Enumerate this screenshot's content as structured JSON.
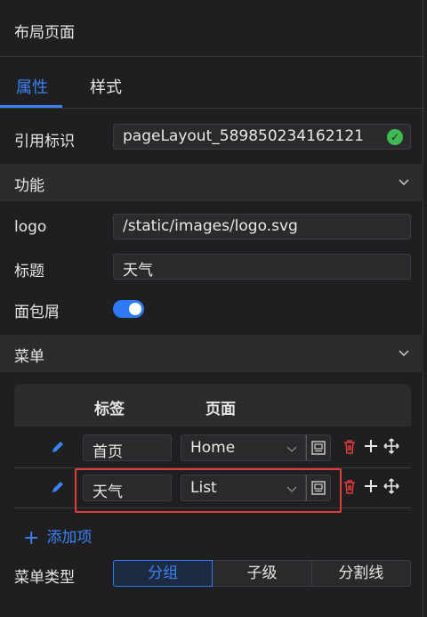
{
  "header": {
    "title": "布局页面"
  },
  "tabs": [
    {
      "label": "属性",
      "active": true
    },
    {
      "label": "样式",
      "active": false
    }
  ],
  "ref_id": {
    "label": "引用标识",
    "value": "pageLayout_589850234162121"
  },
  "section_function": {
    "label": "功能"
  },
  "logo": {
    "label": "logo",
    "value": "/static/images/logo.svg"
  },
  "title_field": {
    "label": "标题",
    "value": "天气"
  },
  "breadcrumb": {
    "label": "面包屑",
    "enabled": true
  },
  "section_menu": {
    "label": "菜单"
  },
  "menu_table": {
    "headers": {
      "tag": "标签",
      "page": "页面"
    },
    "rows": [
      {
        "tag": "首页",
        "page": "Home"
      },
      {
        "tag": "天气",
        "page": "List"
      }
    ]
  },
  "add_item": {
    "label": "添加项"
  },
  "menu_type": {
    "label": "菜单类型",
    "options": [
      "分组",
      "子级",
      "分割线"
    ],
    "selected": "分组"
  },
  "colors": {
    "accent": "#3b82f6",
    "danger": "#e23b3b",
    "success": "#3fb950"
  }
}
